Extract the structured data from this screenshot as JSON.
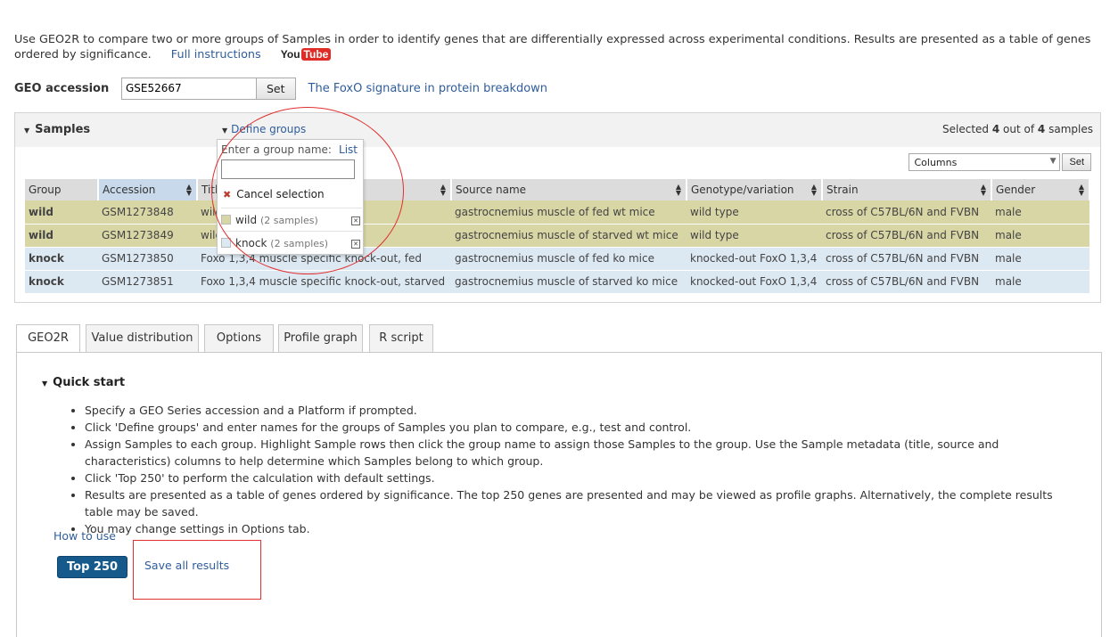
{
  "intro": {
    "text": "Use GEO2R to compare two or more groups of Samples in order to identify genes that are differentially expressed across experimental conditions. Results are presented as a table of genes ordered by significance.",
    "full_instructions": "Full instructions",
    "youtube_you": "You",
    "youtube_tube": "Tube"
  },
  "accession": {
    "label": "GEO accession",
    "value": "GSE52667",
    "set_label": "Set",
    "series_title": "The FoxO signature in protein breakdown"
  },
  "samples": {
    "title": "Samples",
    "define_groups": "Define groups",
    "selected_prefix": "Selected",
    "selected_count": "4",
    "selected_mid": "out of",
    "total_count": "4",
    "selected_suffix": "samples",
    "columns_select": "Columns",
    "columns_set": "Set",
    "headers": [
      "Group",
      "Accession",
      "Title",
      "Source name",
      "Genotype/variation",
      "Strain",
      "Gender"
    ],
    "rows": [
      {
        "group": "wild",
        "accession": "GSM1273848",
        "title": "wild type, fed",
        "source": "gastrocnemius muscle of fed wt mice",
        "genotype": "wild type",
        "strain": "cross of C57BL/6N and FVBN",
        "gender": "male"
      },
      {
        "group": "wild",
        "accession": "GSM1273849",
        "title": "wild type, starved",
        "source": "gastrocnemius muscle of starved wt mice",
        "genotype": "wild type",
        "strain": "cross of C57BL/6N and FVBN",
        "gender": "male"
      },
      {
        "group": "knock",
        "accession": "GSM1273850",
        "title": "Foxo 1,3,4 muscle specific knock-out, fed",
        "source": "gastrocnemius muscle of fed ko mice",
        "genotype": "knocked-out FoxO 1,3,4",
        "strain": "cross of C57BL/6N and FVBN",
        "gender": "male"
      },
      {
        "group": "knock",
        "accession": "GSM1273851",
        "title": "Foxo 1,3,4 muscle specific knock-out, starved",
        "source": "gastrocnemius muscle of starved ko mice",
        "genotype": "knocked-out FoxO 1,3,4",
        "strain": "cross of C57BL/6N and FVBN",
        "gender": "male"
      }
    ]
  },
  "group_popup": {
    "label": "Enter a group name:",
    "list_link": "List",
    "cancel": "Cancel selection",
    "groups": [
      {
        "name": "wild",
        "count": "(2 samples)",
        "color": "#d8d6a5"
      },
      {
        "name": "knock",
        "count": "(2 samples)",
        "color": "#dce8f2"
      }
    ]
  },
  "tabs": [
    "GEO2R",
    "Value distribution",
    "Options",
    "Profile graph",
    "R script"
  ],
  "quick_start": {
    "title": "Quick start",
    "items": [
      "Specify a GEO Series accession and a Platform if prompted.",
      "Click 'Define groups' and enter names for the groups of Samples you plan to compare, e.g., test and control.",
      "Assign Samples to each group. Highlight Sample rows then click the group name to assign those Samples to the group. Use the Sample metadata (title, source and characteristics) columns to help determine which Samples belong to which group.",
      "Click 'Top 250' to perform the calculation with default settings.",
      "Results are presented as a table of genes ordered by significance. The top 250 genes are presented and may be viewed as profile graphs. Alternatively, the complete results table may be saved.",
      "You may change settings in Options tab."
    ],
    "how_to_use": "How to use",
    "top250": "Top 250",
    "save_all": "Save all results"
  }
}
